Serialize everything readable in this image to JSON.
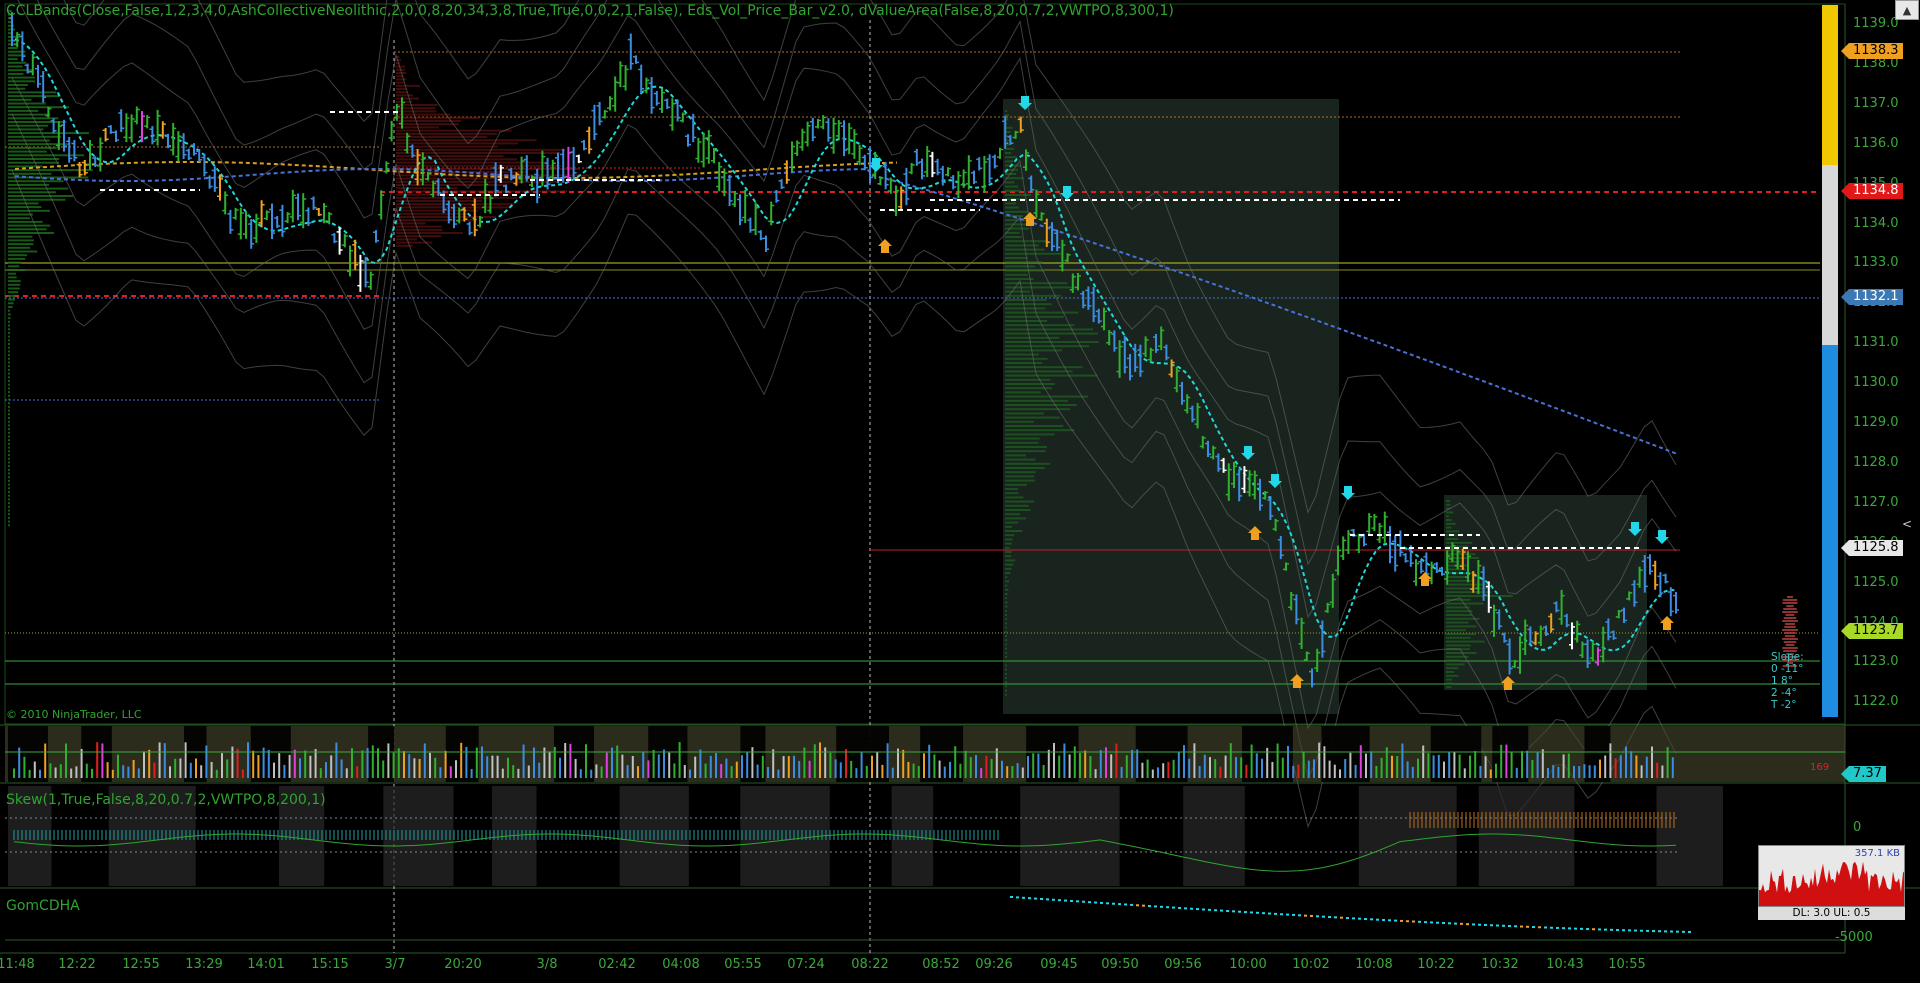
{
  "header": {
    "title": "CCLBands(Close,False,1,2,3,4,0,AshCollectiveNeolithic,2,0,0,8,20,34,3,8,True,True,0,0,2,1,False), Eds_Vol_Price_Bar_v2.0, dValueArea(False,8,20,0.7,2,VWTPO,8,300,1)",
    "copyright": "© 2010 NinjaTrader, LLC"
  },
  "panels": {
    "skew_title": "Skew(1,True,False,8,20,0.7,2,VWTPO,8,200,1)",
    "gom_title": "GomCDHA",
    "skew_zero": "0",
    "gom_level": "-5000",
    "volume_last": "7.37",
    "volume_red_num": "169"
  },
  "price_axis": {
    "labels": [
      "1139.0",
      "1138.0",
      "1137.0",
      "1136.0",
      "1135.0",
      "1134.0",
      "1133.0",
      "1132.0",
      "1131.0",
      "1130.0",
      "1129.0",
      "1128.0",
      "1127.0",
      "1126.0",
      "1125.0",
      "1124.0",
      "1123.0",
      "1122.0"
    ],
    "tags": [
      {
        "value": "1138.3",
        "color": "#f0a020",
        "text_color": "#000000"
      },
      {
        "value": "1134.8",
        "color": "#e01818",
        "text_color": "#ffffff"
      },
      {
        "value": "1132.1",
        "color": "#3c78b4",
        "text_color": "#ffffff"
      },
      {
        "value": "1125.8",
        "color": "#e8e8e8",
        "text_color": "#000000"
      },
      {
        "value": "1123.7",
        "color": "#a8d828",
        "text_color": "#000000"
      }
    ]
  },
  "time_axis": {
    "labels": [
      "11:48",
      "12:22",
      "12:55",
      "13:29",
      "14:01",
      "15:15",
      "3/7",
      "20:20",
      "3/8",
      "02:42",
      "04:08",
      "05:55",
      "07:24",
      "08:22",
      "08:52",
      "09:26",
      "09:45",
      "09:50",
      "09:56",
      "10:00",
      "10:02",
      "10:08",
      "10:22",
      "10:32",
      "10:43",
      "10:55"
    ]
  },
  "stats": {
    "slope_label": "Slope:",
    "rows": [
      "0  -11°",
      "1  8°",
      "2  -4°",
      "T  -2°"
    ]
  },
  "thumbnail": {
    "label": "357.1 KB",
    "footer": "DL: 3.0 UL: 0.5"
  },
  "colors": {
    "up": "#2fb02f",
    "down": "#3c8ce0",
    "ema_cyan": "#20d8d8",
    "vwap_blue": "#4a70d8",
    "poc_red": "#e02020",
    "value_band": "#c8c820",
    "white_dash": "#ffffff",
    "arrow_up": "#f0a020",
    "arrow_down": "#20d8e8"
  }
}
